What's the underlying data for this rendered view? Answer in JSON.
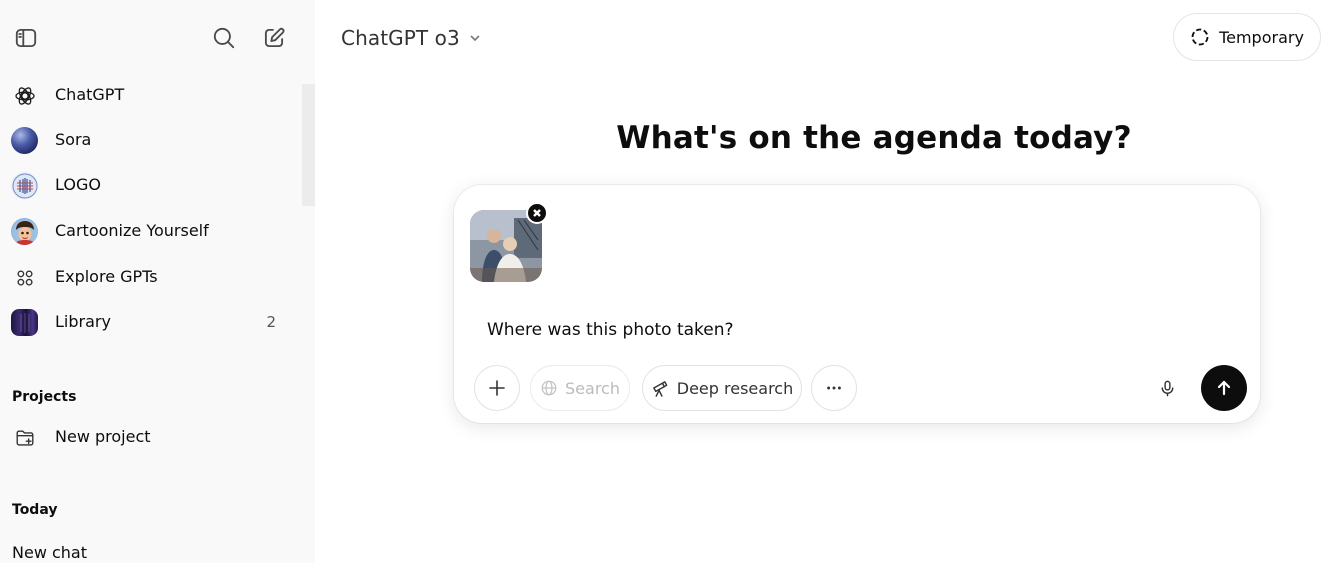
{
  "sidebar": {
    "toggle_icon": "sidebar-toggle-icon",
    "search_icon": "search-icon",
    "new_chat_icon": "new-chat-icon",
    "nav": [
      {
        "label": "ChatGPT",
        "icon": "openai-logo-icon"
      },
      {
        "label": "Sora",
        "icon": "sora-avatar"
      },
      {
        "label": "LOGO",
        "icon": "logo-gpt-avatar"
      },
      {
        "label": "Cartoonize Yourself",
        "icon": "cartoonize-gpt-avatar"
      },
      {
        "label": "Explore GPTs",
        "icon": "grid-icon"
      },
      {
        "label": "Library",
        "icon": "library-thumbnail",
        "count": "2"
      }
    ],
    "projects_title": "Projects",
    "new_project_label": "New project",
    "today_title": "Today",
    "history": [
      "New chat"
    ]
  },
  "header": {
    "model_name": "ChatGPT o3",
    "temporary_label": "Temporary"
  },
  "main": {
    "headline": "What's on the agenda today?"
  },
  "composer": {
    "prompt": "Where was this photo taken?",
    "attachment": "photo-thumbnail",
    "tools": {
      "search_label": "Search",
      "deep_research_label": "Deep research"
    }
  },
  "colors": {
    "sidebar_bg": "#f9f9f9",
    "send_button": "#0d0d0d",
    "text": "#0d0d0d"
  }
}
